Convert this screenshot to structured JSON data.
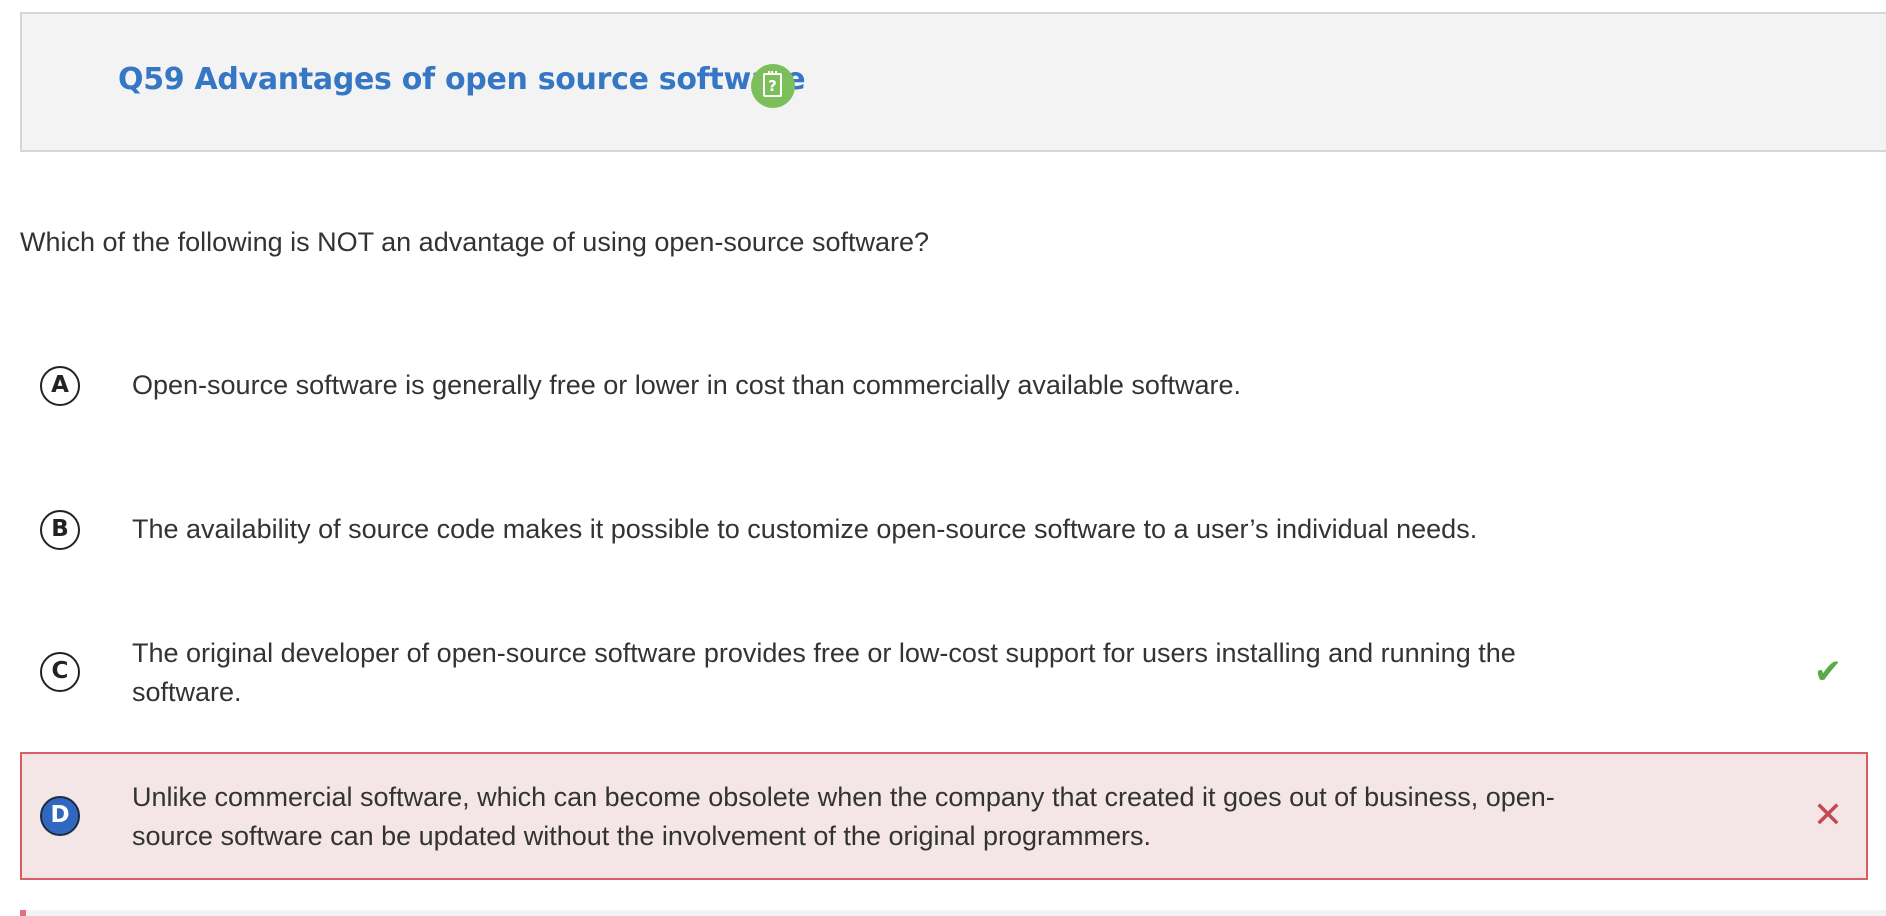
{
  "header": {
    "title": "Q59 Advantages of open source software",
    "help_icon": "question-sheet-icon"
  },
  "question": {
    "text": "Which of the following is NOT an advantage of using open-source software?"
  },
  "options": [
    {
      "letter": "A",
      "text": "Open-source software is generally free or lower in cost than commercially available software.",
      "state": "none"
    },
    {
      "letter": "B",
      "text": "The availability of source code makes it possible to customize open-source software to a user’s individual needs.",
      "state": "none"
    },
    {
      "letter": "C",
      "text": "The original developer of open-source software provides free or low-cost support for users installing and running the software.",
      "state": "correct",
      "mark_icon": "checkmark-icon",
      "mark_glyph": "✔"
    },
    {
      "letter": "D",
      "text": "Unlike commercial software, which can become obsolete when the company that created it goes out of business, open-source software can be updated without the involvement of the original programmers.",
      "state": "selected-incorrect",
      "mark_icon": "cross-icon",
      "mark_glyph": "✕"
    }
  ],
  "colors": {
    "title": "#3577c4",
    "help_icon": "#7cbf5a",
    "correct": "#5aab47",
    "incorrect": "#c24a55",
    "incorrect_bg": "#f4e6e6",
    "selected_badge": "#2f67c1"
  }
}
